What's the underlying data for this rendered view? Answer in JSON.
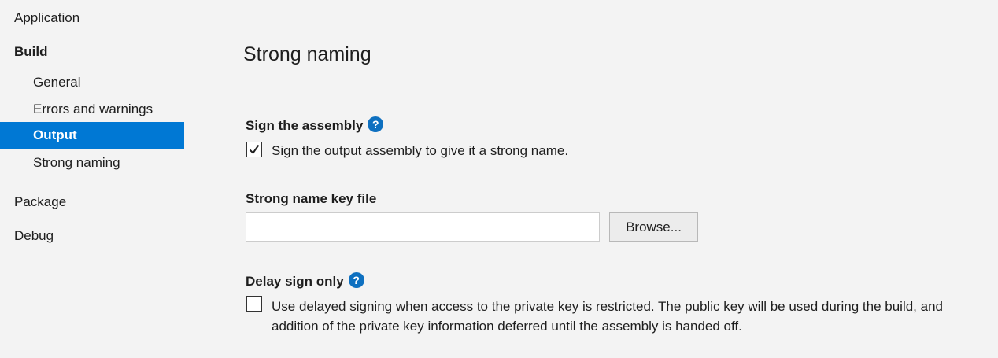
{
  "sidebar": {
    "items": [
      {
        "label": "Application"
      },
      {
        "label": "Build"
      },
      {
        "label": "General"
      },
      {
        "label": "Errors and warnings"
      },
      {
        "label": "Output"
      },
      {
        "label": "Strong naming"
      },
      {
        "label": "Package"
      },
      {
        "label": "Debug"
      }
    ],
    "selected": "Output",
    "accent_color": "#0078d4"
  },
  "main": {
    "title": "Strong naming",
    "sign_assembly": {
      "heading": "Sign the assembly",
      "help_icon": "help-circle-icon",
      "checkbox_checked": true,
      "checkbox_label": "Sign the output assembly to give it a strong name."
    },
    "key_file": {
      "heading": "Strong name key file",
      "value": "",
      "placeholder": "",
      "browse_label": "Browse..."
    },
    "delay_sign": {
      "heading": "Delay sign only",
      "help_icon": "help-circle-icon",
      "checkbox_checked": false,
      "checkbox_label": "Use delayed signing when access to the private key is restricted. The public key will be used during the build, and addition of the private key information deferred until the assembly is handed off."
    },
    "help_icon_glyph": "?",
    "help_icon_color": "#0e70c0"
  }
}
